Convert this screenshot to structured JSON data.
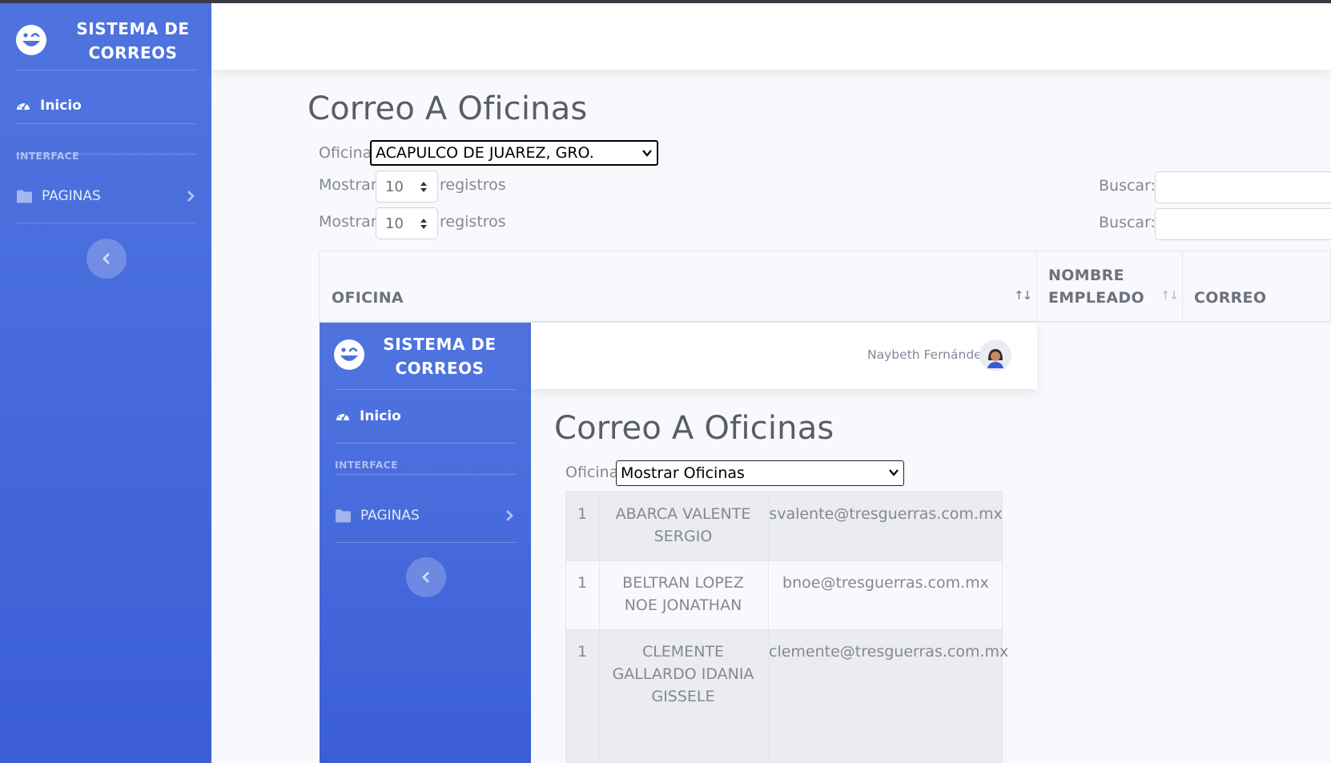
{
  "outer": {
    "brand": "SISTEMA DE CORREOS",
    "nav_inicio": "Inicio",
    "heading_interface": "INTERFACE",
    "nav_paginas": "PAGINAS",
    "page_title": "Correo A Oficinas",
    "oficina_label": "Oficina",
    "oficina_selected": "ACAPULCO DE JUAREZ, GRO.",
    "mostrar_label": "Mostrar",
    "length_value": "10",
    "registros_label": "registros",
    "buscar_label": "Buscar:",
    "columns": [
      "OFICINA",
      "NOMBRE EMPLEADO",
      "CORREO"
    ]
  },
  "inner": {
    "brand": "SISTEMA DE CORREOS",
    "nav_inicio": "Inicio",
    "heading_interface": "INTERFACE",
    "nav_paginas": "PAGINAS",
    "user_name": "Naybeth Fernández",
    "page_title": "Correo A Oficinas",
    "oficina_label": "Oficina",
    "oficina_selected": "Mostrar Oficinas",
    "rows": [
      {
        "num": "1",
        "name": "ABARCA VALENTE SERGIO",
        "email": "svalente@tresguerras.com.mx"
      },
      {
        "num": "1",
        "name": "BELTRAN LOPEZ NOE JONATHAN",
        "email": "bnoe@tresguerras.com.mx"
      },
      {
        "num": "1",
        "name": "CLEMENTE GALLARDO IDANIA GISSELE",
        "email": "clemente@tresguerras.com.mx"
      }
    ]
  },
  "icons": {
    "brand": "laugh-wink-icon",
    "inicio": "tachometer-icon",
    "paginas": "folder-icon",
    "chevron": "chevron-right-icon",
    "toggle": "chevron-left-icon",
    "select": "chevron-down-icon",
    "length": "sort-icon",
    "sort": "sort-arrows-icon",
    "avatar": "user-avatar-icon"
  },
  "colors": {
    "sidebar": "#4e73df",
    "title": "#5a5c69",
    "text": "#858796"
  }
}
